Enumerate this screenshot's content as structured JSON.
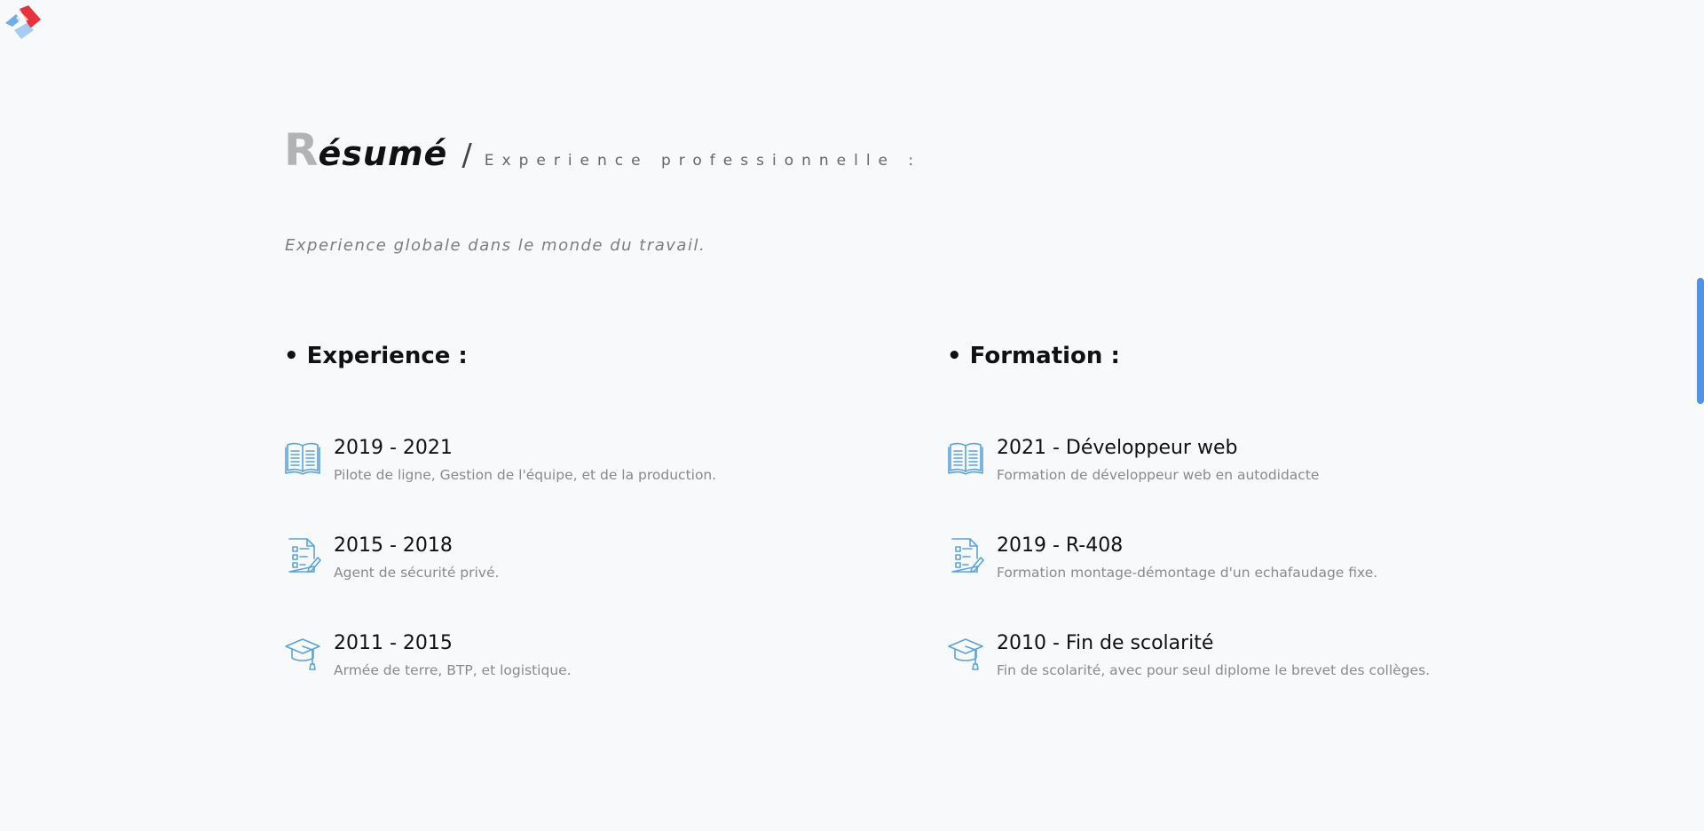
{
  "header": {
    "logo_icon": "logo-diamond-icon"
  },
  "resume": {
    "title_first_letter": "R",
    "title_rest": "ésumé",
    "title_separator": "/",
    "subtitle": "Experience professionnelle :",
    "lead": "Experience globale dans le monde du travail."
  },
  "experience": {
    "heading": "• Experience :",
    "items": [
      {
        "icon": "open-book-icon",
        "title": "2019 - 2021",
        "desc": "Pilote de ligne, Gestion de l'équipe, et de la production."
      },
      {
        "icon": "checklist-document-icon",
        "title": "2015 - 2018",
        "desc": "Agent de sécurité privé."
      },
      {
        "icon": "graduation-cap-icon",
        "title": "2011 - 2015",
        "desc": "Armée de terre, BTP, et logistique."
      }
    ]
  },
  "formation": {
    "heading": "• Formation :",
    "items": [
      {
        "icon": "open-book-icon",
        "title": "2021 - Développeur web",
        "desc": "Formation de développeur web en autodidacte"
      },
      {
        "icon": "checklist-document-icon",
        "title": "2019 - R-408",
        "desc": "Formation montage-démontage d'un echafaudage fixe."
      },
      {
        "icon": "graduation-cap-icon",
        "title": "2010 - Fin de scolarité",
        "desc": "Fin de scolarité, avec pour seul diplome le brevet des collèges."
      }
    ]
  },
  "colors": {
    "accent": "#4f94e8",
    "icon": "#5aa3dc",
    "logo_red": "#e8323c",
    "logo_blue": "#5aa0e6",
    "background": "#f8f9fb"
  }
}
